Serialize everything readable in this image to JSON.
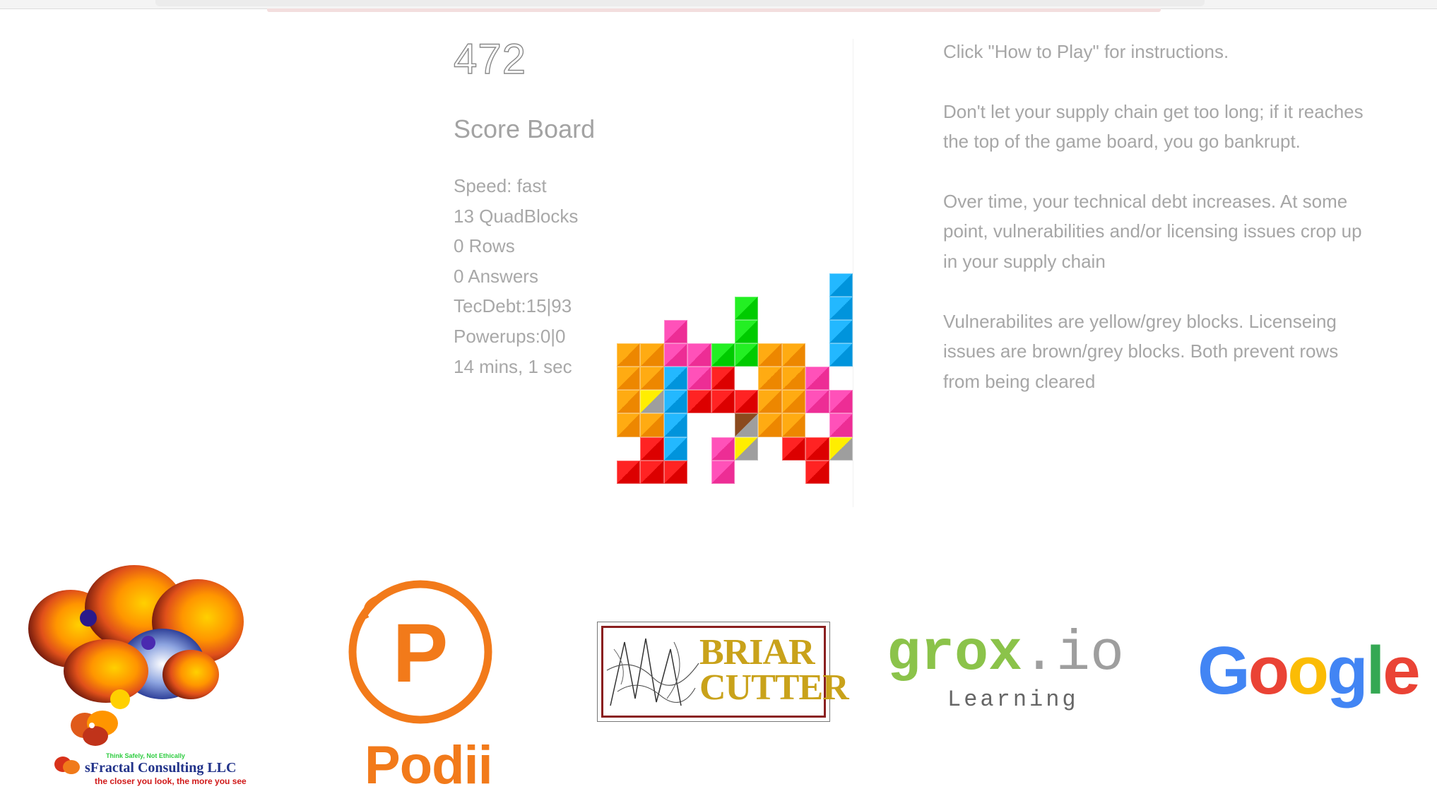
{
  "game": {
    "score": "472",
    "scoreboard_title": "Score Board",
    "stats": [
      "Speed: fast",
      "13 QuadBlocks",
      "0 Rows",
      "0 Answers",
      "TecDebt:15|93",
      "Powerups:0|0",
      "14 mins, 1 sec"
    ],
    "colors": {
      "orange": "#ff9900",
      "red": "#ee1111",
      "pink": "#ff3fa7",
      "blue": "#11a6ee",
      "green": "#11dd11",
      "yellow": "#ffee00",
      "grey": "#9e9e9e",
      "brown": "#8b4a1e"
    },
    "board_cols": 10,
    "board_rows": 20,
    "cells": [
      {
        "r": 10,
        "c": 9,
        "color": "blue"
      },
      {
        "r": 11,
        "c": 5,
        "color": "green"
      },
      {
        "r": 11,
        "c": 9,
        "color": "blue"
      },
      {
        "r": 12,
        "c": 2,
        "color": "pink"
      },
      {
        "r": 12,
        "c": 5,
        "color": "green"
      },
      {
        "r": 12,
        "c": 9,
        "color": "blue"
      },
      {
        "r": 13,
        "c": 0,
        "color": "orange"
      },
      {
        "r": 13,
        "c": 1,
        "color": "orange"
      },
      {
        "r": 13,
        "c": 2,
        "color": "pink"
      },
      {
        "r": 13,
        "c": 3,
        "color": "pink"
      },
      {
        "r": 13,
        "c": 4,
        "color": "green"
      },
      {
        "r": 13,
        "c": 5,
        "color": "green"
      },
      {
        "r": 13,
        "c": 6,
        "color": "orange"
      },
      {
        "r": 13,
        "c": 7,
        "color": "orange"
      },
      {
        "r": 13,
        "c": 9,
        "color": "blue"
      },
      {
        "r": 14,
        "c": 0,
        "color": "orange"
      },
      {
        "r": 14,
        "c": 1,
        "color": "orange"
      },
      {
        "r": 14,
        "c": 2,
        "color": "blue"
      },
      {
        "r": 14,
        "c": 3,
        "color": "pink"
      },
      {
        "r": 14,
        "c": 4,
        "color": "red"
      },
      {
        "r": 14,
        "c": 6,
        "color": "orange"
      },
      {
        "r": 14,
        "c": 7,
        "color": "orange"
      },
      {
        "r": 14,
        "c": 8,
        "color": "pink"
      },
      {
        "r": 15,
        "c": 0,
        "color": "orange"
      },
      {
        "r": 15,
        "c": 1,
        "color": "yellowgrey"
      },
      {
        "r": 15,
        "c": 2,
        "color": "blue"
      },
      {
        "r": 15,
        "c": 3,
        "color": "red"
      },
      {
        "r": 15,
        "c": 4,
        "color": "red"
      },
      {
        "r": 15,
        "c": 5,
        "color": "red"
      },
      {
        "r": 15,
        "c": 6,
        "color": "orange"
      },
      {
        "r": 15,
        "c": 7,
        "color": "orange"
      },
      {
        "r": 15,
        "c": 8,
        "color": "pink"
      },
      {
        "r": 15,
        "c": 9,
        "color": "pink"
      },
      {
        "r": 16,
        "c": 0,
        "color": "orange"
      },
      {
        "r": 16,
        "c": 1,
        "color": "orange"
      },
      {
        "r": 16,
        "c": 2,
        "color": "blue"
      },
      {
        "r": 16,
        "c": 5,
        "color": "browngrey"
      },
      {
        "r": 16,
        "c": 6,
        "color": "orange"
      },
      {
        "r": 16,
        "c": 7,
        "color": "orange"
      },
      {
        "r": 16,
        "c": 9,
        "color": "pink"
      },
      {
        "r": 17,
        "c": 1,
        "color": "red"
      },
      {
        "r": 17,
        "c": 2,
        "color": "blue"
      },
      {
        "r": 17,
        "c": 4,
        "color": "pink"
      },
      {
        "r": 17,
        "c": 5,
        "color": "yellowgrey"
      },
      {
        "r": 17,
        "c": 7,
        "color": "red"
      },
      {
        "r": 17,
        "c": 8,
        "color": "red"
      },
      {
        "r": 17,
        "c": 9,
        "color": "yellowgrey"
      },
      {
        "r": 18,
        "c": 0,
        "color": "red"
      },
      {
        "r": 18,
        "c": 1,
        "color": "red"
      },
      {
        "r": 18,
        "c": 2,
        "color": "red"
      },
      {
        "r": 18,
        "c": 4,
        "color": "pink"
      },
      {
        "r": 18,
        "c": 8,
        "color": "red"
      }
    ]
  },
  "instructions": [
    "Click \"How to Play\" for instructions.",
    "Don't let your supply chain get too long; if it reaches the top of the game board, you go bankrupt.",
    "Over time, your technical debt increases. At some point, vulnerabilities and/or licensing issues crop up in your supply chain",
    "Vulnerabilites are yellow/grey blocks. Licenseing issues are brown/grey blocks. Both prevent rows from being cleared"
  ],
  "sponsors": {
    "sfractal": {
      "tagline": "Think Safely, Not Ethically",
      "name": "sFractal Consulting LLC",
      "slogan": "the closer you look, the more you see"
    },
    "podii": {
      "letter": "P",
      "name": "Podii"
    },
    "briar": {
      "line1": "BRIAR",
      "line2": "CUTTER"
    },
    "grox": {
      "main_g": "grox",
      "main_io": ".io",
      "sub": "Learning"
    },
    "google": {
      "letters": [
        "G",
        "o",
        "o",
        "g",
        "l",
        "e"
      ],
      "colors": [
        "#4285F4",
        "#EA4335",
        "#FBBC05",
        "#4285F4",
        "#34A853",
        "#EA4335"
      ]
    }
  }
}
